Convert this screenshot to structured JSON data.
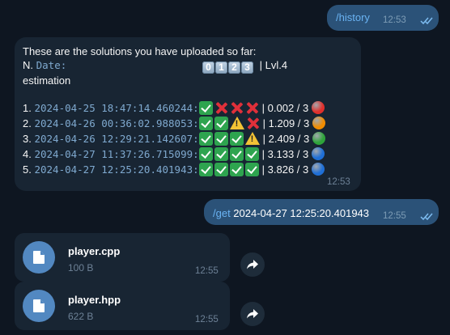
{
  "colors": {
    "background": "#0e1621",
    "outgoing_bubble": "#2b5278",
    "incoming_bubble": "#182533",
    "command_link": "#6ab3f3",
    "file_icon": "#5288c1"
  },
  "messages": {
    "history_cmd": {
      "text": "/history",
      "time": "12:53",
      "status": "read"
    },
    "history_reply": {
      "intro": "These are the solutions you have uploaded so far:",
      "header_n": "N.",
      "header_date": "Date:",
      "header_keycaps": [
        "0",
        "1",
        "2",
        "3"
      ],
      "header_lvl": "| Lvl.4",
      "header_estimation": "estimation",
      "rows": [
        {
          "n": "1.",
          "date": "2024-04-25 18:47:14.460244:",
          "results": [
            "check",
            "cross",
            "cross",
            "cross"
          ],
          "score": "| 0.002 / 3",
          "dot_color": "#e0302c"
        },
        {
          "n": "2.",
          "date": "2024-04-26 00:36:02.988053:",
          "results": [
            "check",
            "check",
            "warn",
            "cross"
          ],
          "score": "| 1.209 / 3",
          "dot_color": "#f08c00"
        },
        {
          "n": "3.",
          "date": "2024-04-26 12:29:21.142607:",
          "results": [
            "check",
            "check",
            "check",
            "warn"
          ],
          "score": "| 2.409 / 3",
          "dot_color": "#2ea43a"
        },
        {
          "n": "4.",
          "date": "2024-04-27 11:37:26.715099:",
          "results": [
            "check",
            "check",
            "check",
            "check"
          ],
          "score": "| 3.133 / 3",
          "dot_color": "#1f6fd6"
        },
        {
          "n": "5.",
          "date": "2024-04-27 12:25:20.401943:",
          "results": [
            "check",
            "check",
            "check",
            "check"
          ],
          "score": "| 3.826 / 3",
          "dot_color": "#1f6fd6"
        }
      ],
      "time": "12:53"
    },
    "get_cmd": {
      "command": "/get",
      "argument": " 2024-04-27 12:25:20.401943",
      "time": "12:55",
      "status": "read"
    },
    "files": [
      {
        "name": "player.cpp",
        "size": "100 B",
        "time": "12:55",
        "icon": "file-icon"
      },
      {
        "name": "player.hpp",
        "size": "622 B",
        "time": "12:55",
        "icon": "file-icon"
      }
    ]
  }
}
